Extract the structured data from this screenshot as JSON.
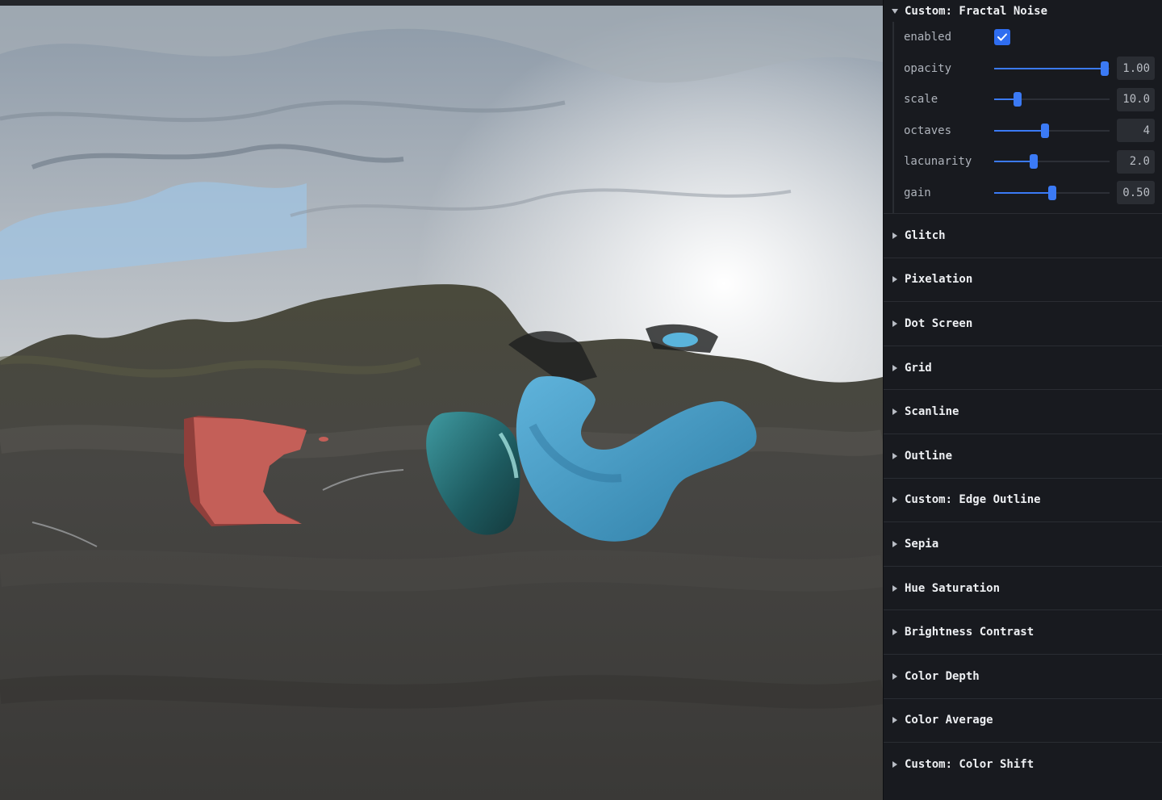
{
  "panel": {
    "open_folder": {
      "title": "Custom: Fractal Noise",
      "controls": [
        {
          "label": "enabled",
          "type": "checkbox",
          "checked": true
        },
        {
          "label": "opacity",
          "type": "slider",
          "value": "1.00",
          "fraction": 0.96
        },
        {
          "label": "scale",
          "type": "slider",
          "value": "10.0",
          "fraction": 0.2
        },
        {
          "label": "octaves",
          "type": "slider",
          "value": "4",
          "fraction": 0.44
        },
        {
          "label": "lacunarity",
          "type": "slider",
          "value": "2.0",
          "fraction": 0.34
        },
        {
          "label": "gain",
          "type": "slider",
          "value": "0.50",
          "fraction": 0.5
        }
      ]
    },
    "closed_folders": [
      "Glitch",
      "Pixelation",
      "Dot Screen",
      "Grid",
      "Scanline",
      "Outline",
      "Custom: Edge Outline",
      "Sepia",
      "Hue Saturation",
      "Brightness Contrast",
      "Color Depth",
      "Color Average",
      "Custom: Color Shift"
    ]
  },
  "colors": {
    "accent": "#3b7af5",
    "panel_bg": "#181a1f"
  }
}
